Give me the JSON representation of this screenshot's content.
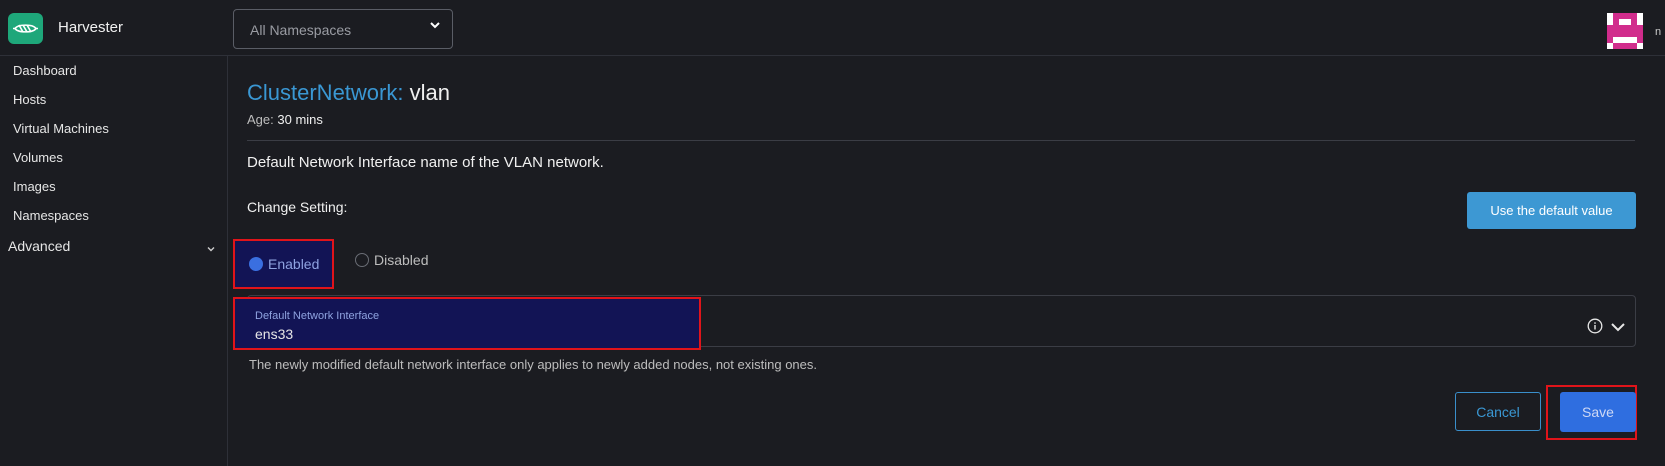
{
  "app": {
    "title": "Harvester"
  },
  "header": {
    "namespace_select": {
      "value": "All Namespaces"
    },
    "edge_text": "n"
  },
  "sidebar": {
    "items": [
      {
        "label": "Dashboard"
      },
      {
        "label": "Hosts"
      },
      {
        "label": "Virtual Machines"
      },
      {
        "label": "Volumes"
      },
      {
        "label": "Images"
      },
      {
        "label": "Namespaces"
      }
    ],
    "advanced": {
      "label": "Advanced"
    }
  },
  "page": {
    "kind": "ClusterNetwork:",
    "name": "vlan",
    "age_label": "Age:",
    "age_value": "30 mins",
    "description": "Default Network Interface name of the VLAN network.",
    "change_label": "Change Setting:",
    "default_button": "Use the default value",
    "radio_enabled": "Enabled",
    "radio_disabled": "Disabled",
    "selected": "Enabled",
    "field": {
      "label": "Default Network Interface",
      "value": "ens33"
    },
    "hint": "The newly modified default network interface only applies to newly added nodes, not existing ones.",
    "cancel_button": "Cancel",
    "save_button": "Save"
  },
  "colors": {
    "accent": "#3a97d3",
    "primary": "#2f6ee0",
    "highlight_border": "#e0141a",
    "highlight_fill": "#121455",
    "logo": "#1ea77a",
    "avatar": "#d12c8c"
  },
  "icons": {
    "logo": "harvester-logo-icon",
    "namespace_dropdown": "chevron-down-icon",
    "advanced_toggle": "chevron-down-icon",
    "field_info": "info-icon",
    "field_dropdown": "chevron-down-icon",
    "avatar": "user-avatar-icon"
  }
}
